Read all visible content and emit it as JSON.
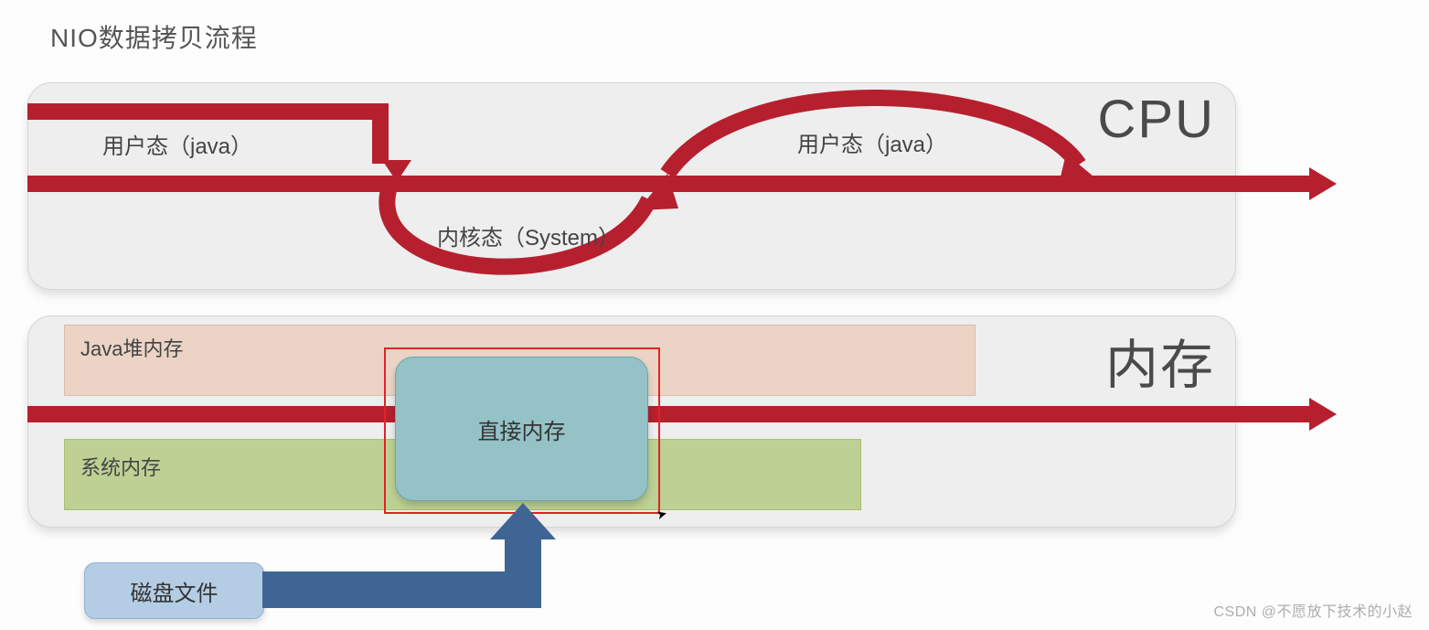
{
  "title": "NIO数据拷贝流程",
  "cpu": {
    "label": "CPU",
    "user1": "用户态（java）",
    "user2": "用户态（java）",
    "kernel": "内核态（System）"
  },
  "memory": {
    "label": "内存",
    "java_heap": "Java堆内存",
    "system_mem": "系统内存",
    "direct_mem": "直接内存"
  },
  "disk": "磁盘文件",
  "watermark": "CSDN @不愿放下技术的小赵",
  "colors": {
    "red": "#b6202e",
    "blue": "#3e6594",
    "heap": "#ebd4c6",
    "sysmem": "#bed194",
    "direct": "#94c2c7",
    "disk": "#b4cde4"
  }
}
